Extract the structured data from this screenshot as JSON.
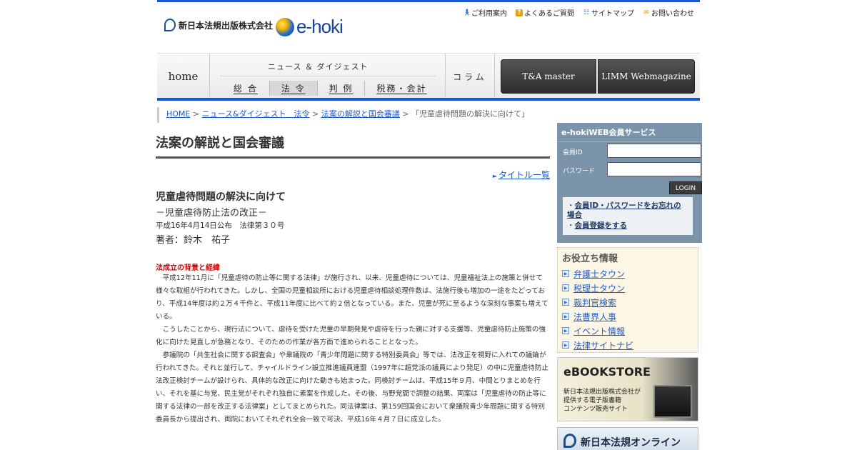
{
  "header": {
    "company": "新日本法規出版株式会社",
    "brand": "e-hoki",
    "utility_links": [
      {
        "label": "ご利用案内",
        "icon": "person-icon"
      },
      {
        "label": "よくあるご質問",
        "icon": "question-icon"
      },
      {
        "label": "サイトマップ",
        "icon": "sitemap-icon"
      },
      {
        "label": "お問い合わせ",
        "icon": "mail-icon"
      }
    ]
  },
  "nav": {
    "home": "home",
    "news_title": "ニュース ＆ ダイジェスト",
    "subnav": [
      "総 合",
      "法 令",
      "判 例",
      "税務・会計"
    ],
    "column": "コラム",
    "ta_master": "T&A master",
    "limm": "LIMM Webmagazine"
  },
  "breadcrumb": {
    "home": "HOME",
    "news": "ニュース&ダイジェスト　法令",
    "section": "法案の解説と国会審議",
    "current": "「児童虐待問題の解決に向けて」",
    "sep": ">"
  },
  "main": {
    "heading": "法案の解説と国会審議",
    "title_list": "タイトル一覧",
    "article": {
      "title": "児童虐待問題の解決に向けて",
      "subtitle": "－児童虐待防止法の改正－",
      "meta": "平成16年4月14日公布　法律第３０号",
      "author": "著者：鈴木　祐子",
      "section_heading": "法成立の背景と経緯",
      "paragraphs": [
        "平成12年11月に「児童虐待の防止等に関する法律」が施行され、以来、児童虐待については、児童福祉法上の施策と併せて様々な取組が行われてきた。しかし、全国の児童相談所における児童虐待相談処理件数は、法施行後も増加の一途をたどっており、平成14年度は約２万４千件と、平成11年度に比べて約２倍となっている。また、児童が死に至るような深刻な事案も増えている。",
        "こうしたことから、現行法について、虐待を受けた児童の早期発見や虐待を行った親に対する支援等、児童虐待防止施策の強化に向けた見直しが急務となり、そのための作業が各方面で進められることとなった。",
        "参議院の「共生社会に関する調査会」や衆議院の「青少年問題に関する特別委員会」等では、法改正を視野に入れての議論が行われてきた。それと並行して、チャイルドライン設立推進議員連盟（1997年に超党派の議員により発足）の中に児童虐待防止法改正検討チームが設けられ、具体的な改正に向けた動きも始まった。同検討チームは、平成15年９月、中間とりまとめを行い、それを基に与党、民主党がそれぞれ独自に素案を作成した。その後、与野党間で調整の結果、両案は「児童虐待の防止等に関する法律の一部を改正する法律案」としてまとめられた。同法律案は、第159回国会において衆議院青少年問題に関する特別委員長から提出され、両院においてそれぞれ全会一致で可決、平成16年４月７日に成立した。"
      ]
    }
  },
  "sidebar": {
    "member": {
      "title": "e-hokiWEB会員サービス",
      "id_label": "会員ID",
      "pw_label": "パスワード",
      "id_value": "",
      "pw_value": "",
      "login": "LOGIN",
      "links": [
        "会員ID・パスワードをお忘れの場合",
        "会員登録をする"
      ]
    },
    "useful": {
      "title": "お役立ち情報",
      "items": [
        "弁護士タウン",
        "税理士タウン",
        "裁判官検索",
        "法曹界人事",
        "イベント情報",
        "法律サイトナビ"
      ]
    },
    "ebook": {
      "title": "eBOOKSTORE",
      "lines": [
        "新日本法規出版株式会社が",
        "提供する電子版書籍",
        "コンテンツ販売サイト"
      ]
    },
    "online": "新日本法規オンライン"
  },
  "colors": {
    "accent_blue": "#1a56d6",
    "link": "#1f5bc9",
    "alert_red": "#d40000",
    "member_bg": "#7b94a9"
  }
}
